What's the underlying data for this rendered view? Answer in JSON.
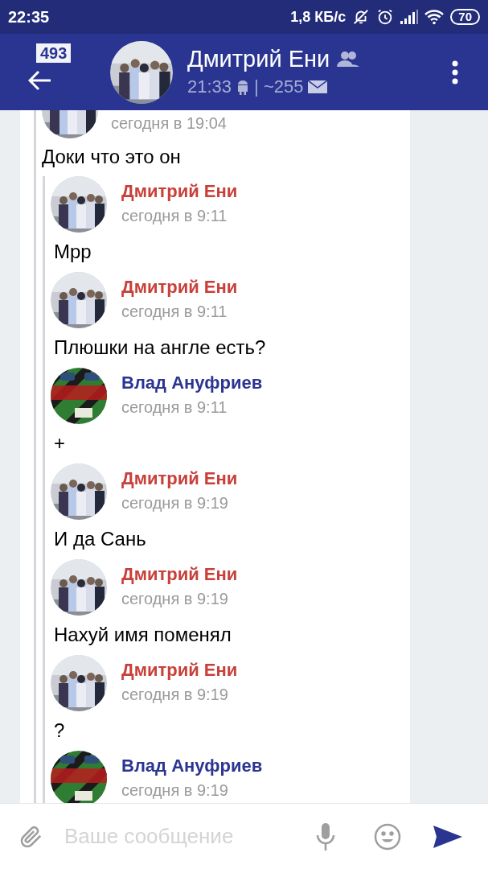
{
  "status_bar": {
    "time": "22:35",
    "network_speed": "1,8 КБ/с",
    "battery": "70"
  },
  "header": {
    "unread_badge": "493",
    "title": "Дмитрий Ени",
    "last_seen": "21:33",
    "counter": "| ~255"
  },
  "quoted_message": {
    "time": "сегодня в 19:04",
    "text": "Доки что это он"
  },
  "nested_messages": [
    {
      "author": "Дмитрий Ени",
      "color": "#c9403a",
      "time": "сегодня в 9:11",
      "text": "Мрр"
    },
    {
      "author": "Дмитрий Ени",
      "color": "#c9403a",
      "time": "сегодня в 9:11",
      "text": "Плюшки на англе есть?"
    },
    {
      "author": "Влад Ануфриев",
      "color": "#2b3592",
      "time": "сегодня в 9:11",
      "text": "+"
    },
    {
      "author": "Дмитрий Ени",
      "color": "#c9403a",
      "time": "сегодня в 9:19",
      "text": "И да Сань"
    },
    {
      "author": "Дмитрий Ени",
      "color": "#c9403a",
      "time": "сегодня в 9:19",
      "text": "Нахуй имя поменял"
    },
    {
      "author": "Дмитрий Ени",
      "color": "#c9403a",
      "time": "сегодня в 9:19",
      "text": "?"
    },
    {
      "author": "Влад Ануфриев",
      "color": "#2b3592",
      "time": "сегодня в 9:19"
    }
  ],
  "composer": {
    "placeholder": "Ваше сообщение"
  }
}
